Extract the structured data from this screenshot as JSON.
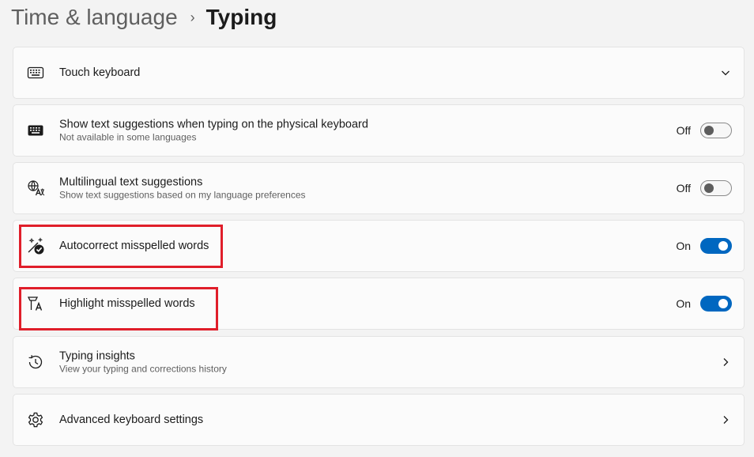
{
  "breadcrumb": {
    "parent": "Time & language",
    "separator": "›",
    "current": "Typing"
  },
  "settings": [
    {
      "icon": "keyboard-icon",
      "title": "Touch keyboard",
      "control": "expand-chevron"
    },
    {
      "icon": "keyboard-filled-icon",
      "title": "Show text suggestions when typing on the physical keyboard",
      "description": "Not available in some languages",
      "state": "Off",
      "toggle_on": false
    },
    {
      "icon": "multilingual-icon",
      "title": "Multilingual text suggestions",
      "description": "Show text suggestions based on my language preferences",
      "state": "Off",
      "toggle_on": false
    },
    {
      "icon": "autocorrect-icon",
      "title": "Autocorrect misspelled words",
      "state": "On",
      "toggle_on": true
    },
    {
      "icon": "highlight-spelling-icon",
      "title": "Highlight misspelled words",
      "state": "On",
      "toggle_on": true
    },
    {
      "icon": "history-icon",
      "title": "Typing insights",
      "description": "View your typing and corrections history",
      "control": "navigate-chevron"
    },
    {
      "icon": "gear-icon",
      "title": "Advanced keyboard settings",
      "control": "navigate-chevron"
    }
  ],
  "colors": {
    "accent": "#0067c0",
    "annotation_red": "#e01e2a",
    "background": "#f3f3f3",
    "card": "#fbfbfb"
  }
}
